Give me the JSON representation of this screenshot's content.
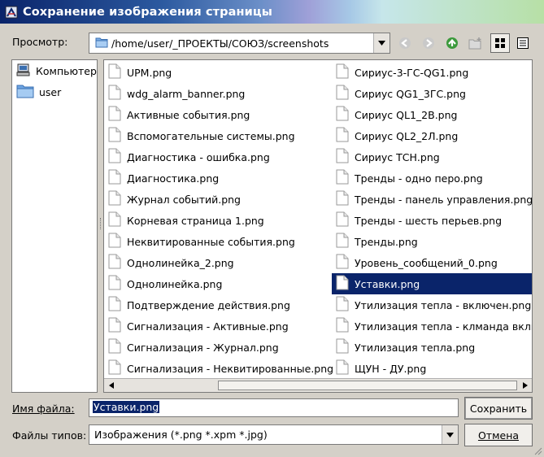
{
  "window": {
    "title": "Сохранение изображения страницы",
    "icon": "app-icon"
  },
  "lookin": {
    "label": "Просмотр:",
    "path": "/home/user/_ПРОЕКТЫ/СОЮЗ/screenshots",
    "toolbar": [
      "back-icon",
      "forward-icon",
      "up-folder-icon",
      "new-folder-icon",
      "icon-view-icon",
      "detail-view-icon"
    ]
  },
  "sidebar": {
    "items": [
      {
        "label": "Компьютер",
        "icon": "computer-icon"
      },
      {
        "label": "user",
        "icon": "folder-icon"
      }
    ]
  },
  "files": {
    "column1": [
      "UPM.png",
      "wdg_alarm_banner.png",
      "Активные события.png",
      "Вспомогательные системы.png",
      "Диагностика - ошибка.png",
      "Диагностика.png",
      "Журнал событий.png",
      "Корневая страница 1.png",
      "Неквитированные события.png",
      "Однолинейка_2.png",
      "Однолинейка.png",
      "Подтверждение действия.png",
      "Сигнализация - Активные.png",
      "Сигнализация - Журнал.png",
      "Сигнализация - Неквитированные.png"
    ],
    "column2": [
      "Сириус-3-ГС-QG1.png",
      "Сириус QG1_3ГС.png",
      "Сириус QL1_2В.png",
      "Сириус QL2_2Л.png",
      "Сириус ТСН.png",
      "Тренды - одно перо.png",
      "Тренды - панель управления.png",
      "Тренды - шесть перьев.png",
      "Тренды.png",
      "Уровень_сообщений_0.png",
      "Уставки.png",
      "Утилизация тепла - включен.png",
      "Утилизация тепла - клманда вклю",
      "Утилизация тепла.png",
      "ЩУН - ДУ.png"
    ],
    "selected": "Уставки.png"
  },
  "filename": {
    "label": "Имя файла:",
    "value": "Уставки.png",
    "save_button": "Сохранить"
  },
  "filetype": {
    "label": "Файлы типов:",
    "value": "Изображения (*.png *.xpm *.jpg)",
    "cancel_button": "Отмена"
  },
  "colors": {
    "title_gradient_start": "#0a246a",
    "selection": "#0a246a",
    "dialog_bg": "#d4d0c8"
  }
}
